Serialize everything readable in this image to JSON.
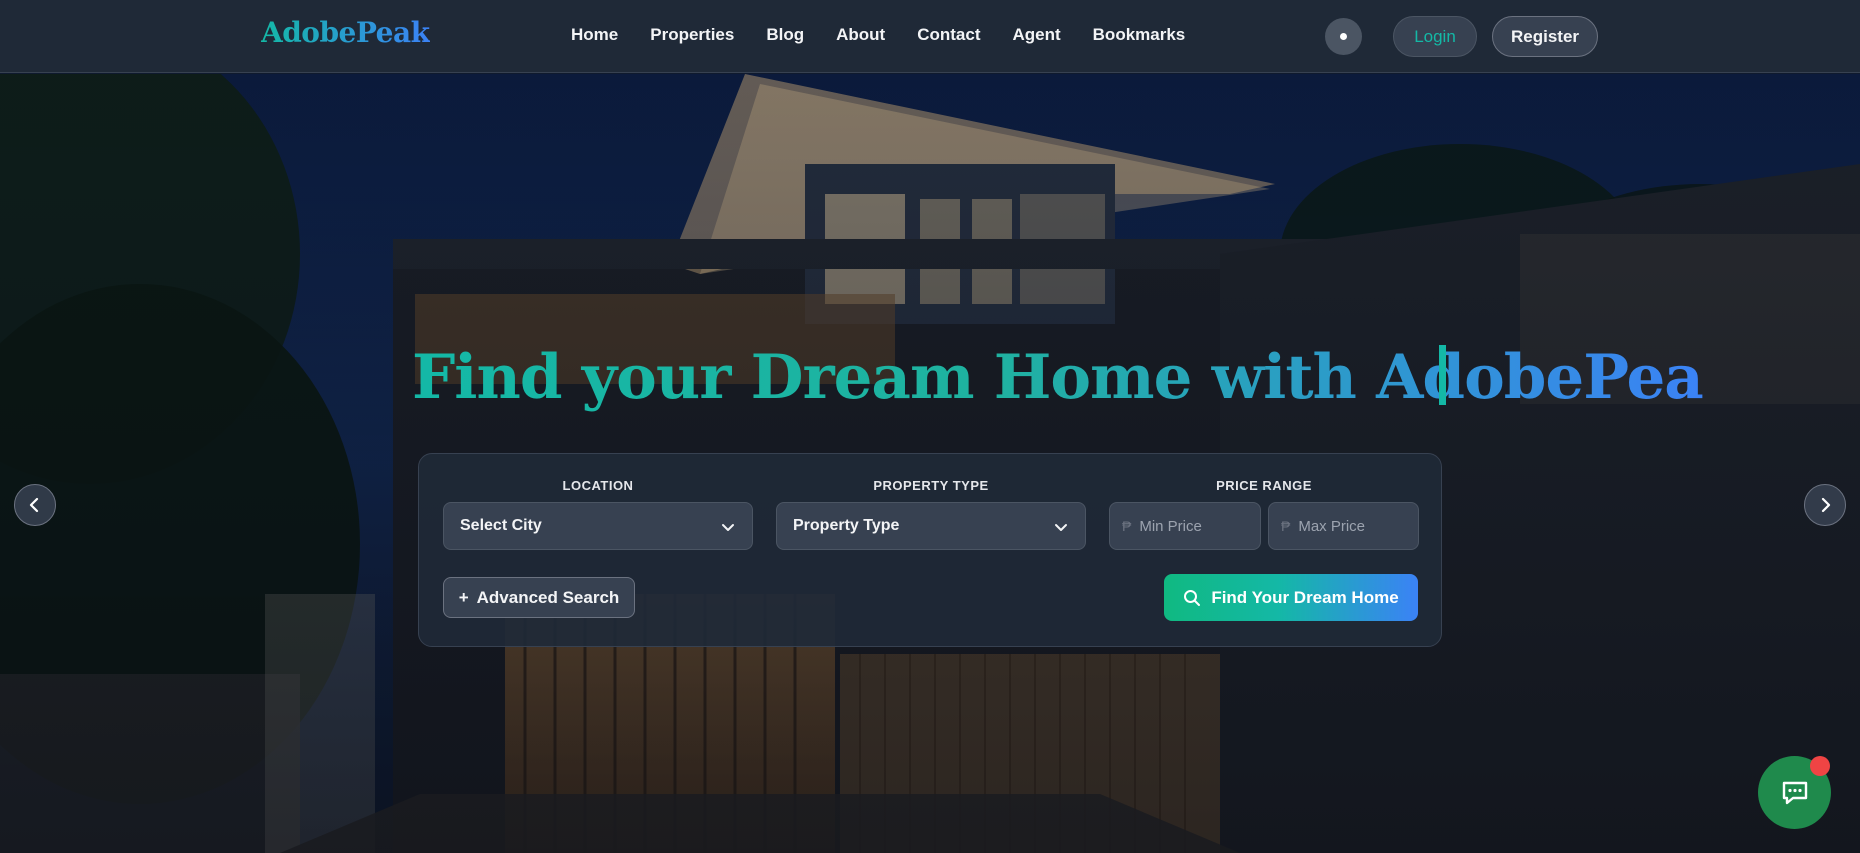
{
  "header": {
    "logo": "AdobePeak",
    "nav": [
      "Home",
      "Properties",
      "Blog",
      "About",
      "Contact",
      "Agent",
      "Bookmarks"
    ],
    "login_label": "Login",
    "register_label": "Register"
  },
  "hero": {
    "headline": "Find your Dream Home with AdobePea"
  },
  "search": {
    "location_label": "LOCATION",
    "location_value": "Select City",
    "type_label": "PROPERTY TYPE",
    "type_value": "Property Type",
    "price_label": "PRICE RANGE",
    "currency_symbol": "₱",
    "min_price_placeholder": "Min Price",
    "max_price_placeholder": "Max Price",
    "advanced_label": "Advanced Search",
    "advanced_prefix": "+",
    "submit_label": "Find Your Dream Home"
  },
  "colors": {
    "accent_teal": "#14b8a6",
    "accent_blue": "#3b82f6",
    "header_bg": "#1f2937",
    "chat_green": "#1f8a4c",
    "badge_red": "#ef4444"
  },
  "icons": {
    "theme": "theme-toggle-icon",
    "prev": "chevron-left-icon",
    "next": "chevron-right-icon",
    "search": "search-icon",
    "chat": "chat-icon"
  }
}
